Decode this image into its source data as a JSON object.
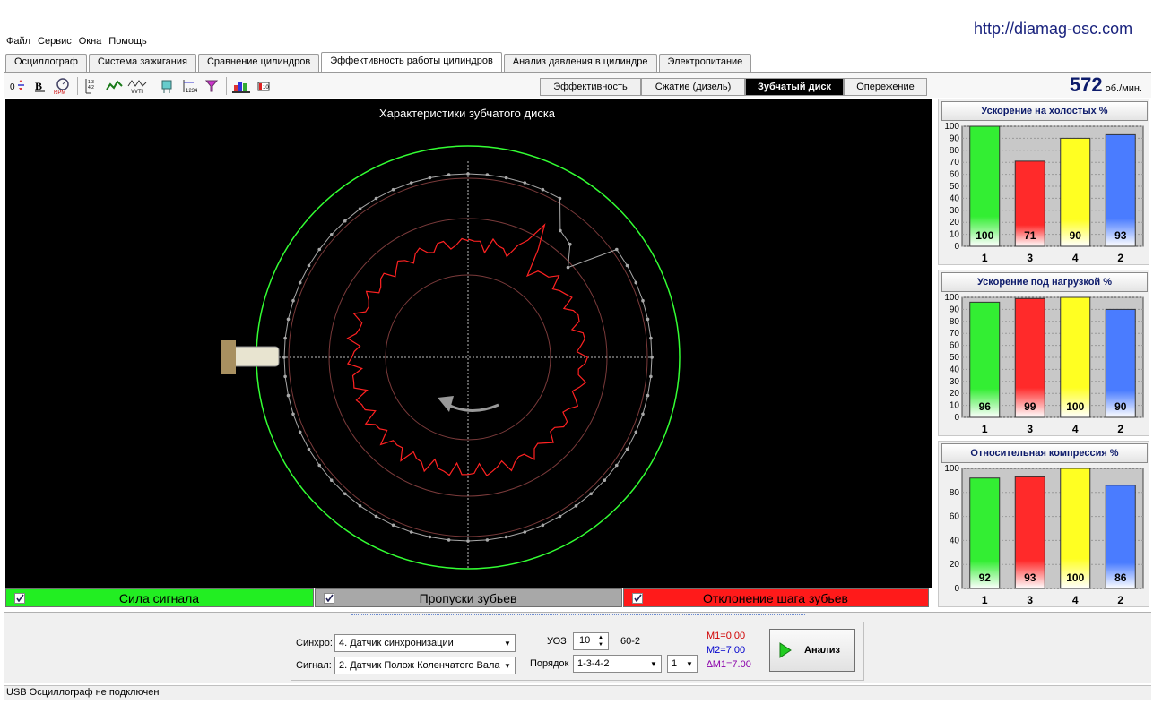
{
  "url": "http://diamag-osc.com",
  "menu": [
    "Файл",
    "Сервис",
    "Окна",
    "Помощь"
  ],
  "tabs": [
    {
      "label": "Осциллограф",
      "active": false
    },
    {
      "label": "Система зажигания",
      "active": false
    },
    {
      "label": "Сравнение цилиндров",
      "active": false
    },
    {
      "label": "Эффективность работы цилиндров",
      "active": true
    },
    {
      "label": "Анализ давления в цилиндре",
      "active": false
    },
    {
      "label": "Электропитание",
      "active": false
    }
  ],
  "toolbar_icons": [
    "offset-icon",
    "bold-icon",
    "rpm-icon",
    "sequence-icon",
    "wave-icon",
    "vvti-icon",
    "sensor-icon",
    "marker-icon",
    "filter-icon",
    "cars-icon",
    "battery-icon"
  ],
  "subtabs": [
    {
      "label": "Эффективность",
      "active": false
    },
    {
      "label": "Сжатие (дизель)",
      "active": false
    },
    {
      "label": "Зубчатый диск",
      "active": true
    },
    {
      "label": "Опережение",
      "active": false
    }
  ],
  "rpm": {
    "value": "572",
    "unit": "об./мин."
  },
  "plot": {
    "title": "Характеристики зубчатого диска",
    "colors": {
      "signal": "#33ff33",
      "missing": "#a8a8a8",
      "deviation": "#ff2222"
    }
  },
  "legend": [
    {
      "label": "Сила сигнала",
      "color": "#22ee22",
      "checked": true
    },
    {
      "label": "Пропуски зубьев",
      "color": "#a8a8a8",
      "checked": true
    },
    {
      "label": "Отклонение шага зубьев",
      "color": "#ff1a1a",
      "checked": true
    }
  ],
  "charts": [
    {
      "title": "Ускорение на холостых %",
      "yticks": [
        "100",
        "90",
        "80",
        "70",
        "60",
        "50",
        "40",
        "30",
        "20",
        "10",
        "0"
      ],
      "categories": [
        "1",
        "3",
        "4",
        "2"
      ],
      "values": [
        100,
        71,
        90,
        93
      ],
      "colors": [
        "#33ee33",
        "#ff2a2a",
        "#ffff22",
        "#4a7cff"
      ]
    },
    {
      "title": "Ускорение под нагрузкой %",
      "yticks": [
        "100",
        "90",
        "80",
        "70",
        "60",
        "50",
        "40",
        "30",
        "20",
        "10",
        "0"
      ],
      "categories": [
        "1",
        "3",
        "4",
        "2"
      ],
      "values": [
        96,
        99,
        100,
        90
      ],
      "colors": [
        "#33ee33",
        "#ff2a2a",
        "#ffff22",
        "#4a7cff"
      ]
    },
    {
      "title": "Относительная компрессия %",
      "yticks": [
        "100",
        "80",
        "60",
        "40",
        "20",
        "0"
      ],
      "categories": [
        "1",
        "3",
        "4",
        "2"
      ],
      "values": [
        92,
        93,
        100,
        86
      ],
      "colors": [
        "#33ee33",
        "#ff2a2a",
        "#ffff22",
        "#4a7cff"
      ]
    }
  ],
  "controls": {
    "sync_label": "Синхро:",
    "sync_value": "4.  Датчик синхронизации",
    "signal_label": "Сигнал:",
    "signal_value": "2.  Датчик Полож Коленчатого Вала",
    "uoz_label": "УОЗ",
    "uoz_value": "10",
    "teeth": "60-2",
    "order_label": "Порядок",
    "order_value": "1-3-4-2",
    "cyl_value": "1",
    "m1": "M1=0.00",
    "m2": "M2=7.00",
    "dm": "∆M1=7.00",
    "analyze": "Анализ"
  },
  "status": "USB Осциллограф не подключен"
}
